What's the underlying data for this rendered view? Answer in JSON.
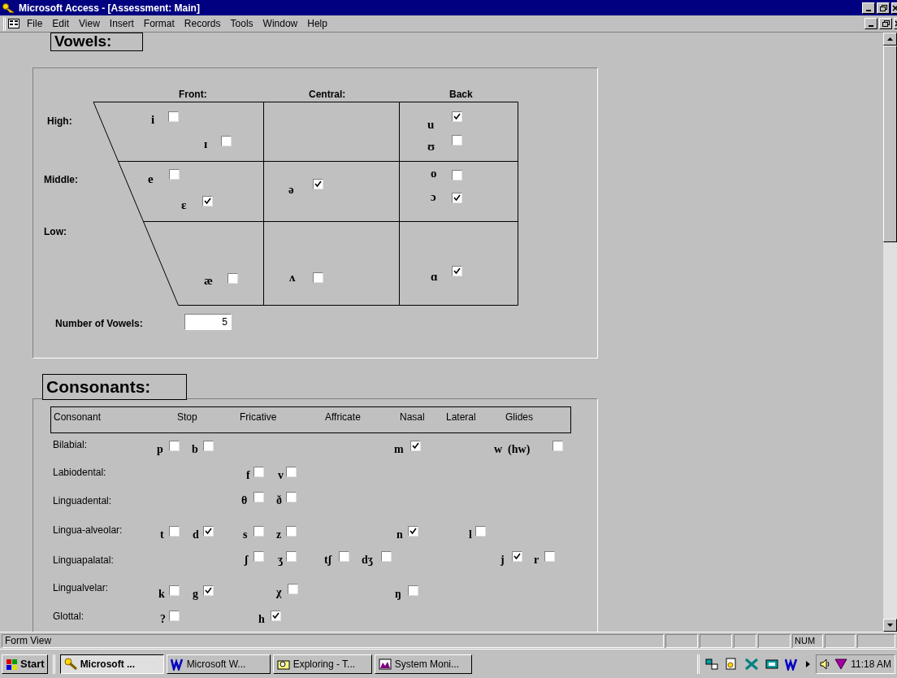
{
  "window": {
    "title": "Microsoft Access - [Assessment: Main]"
  },
  "menu": [
    "File",
    "Edit",
    "View",
    "Insert",
    "Format",
    "Records",
    "Tools",
    "Window",
    "Help"
  ],
  "vowels": {
    "title": "Vowels:",
    "columns": [
      "Front:",
      "Central:",
      "Back"
    ],
    "rows": [
      "High:",
      "Middle:",
      "Low:"
    ],
    "items": [
      {
        "symbol": "i",
        "checked": false
      },
      {
        "symbol": "ɪ",
        "checked": false
      },
      {
        "symbol": "e",
        "checked": false
      },
      {
        "symbol": "ɛ",
        "checked": true
      },
      {
        "symbol": "æ",
        "checked": false
      },
      {
        "symbol": "ə",
        "checked": true
      },
      {
        "symbol": "ʌ",
        "checked": false
      },
      {
        "symbol": "u",
        "checked": true
      },
      {
        "symbol": "ʊ",
        "checked": false
      },
      {
        "symbol": "o",
        "checked": false
      },
      {
        "symbol": "ɔ",
        "checked": true
      },
      {
        "symbol": "ɑ",
        "checked": true
      }
    ],
    "count_label": "Number of Vowels:",
    "count": "5"
  },
  "consonants": {
    "title": "Consonants:",
    "columns": [
      "Consonant",
      "Stop",
      "Fricative",
      "Affricate",
      "Nasal",
      "Lateral",
      "Glides"
    ],
    "rows": [
      "Bilabial:",
      "Labiodental:",
      "Linguadental:",
      "Lingua-alveolar:",
      "Linguapalatal:",
      "Lingualvelar:",
      "Glottal:"
    ],
    "items": [
      {
        "symbol": "p",
        "checked": false
      },
      {
        "symbol": "b",
        "checked": false
      },
      {
        "symbol": "m",
        "checked": true
      },
      {
        "symbol": "w  (hw)",
        "checked": false
      },
      {
        "symbol": "f",
        "checked": false
      },
      {
        "symbol": "v",
        "checked": false
      },
      {
        "symbol": "θ",
        "checked": false
      },
      {
        "symbol": "ð",
        "checked": false
      },
      {
        "symbol": "t",
        "checked": false
      },
      {
        "symbol": "d",
        "checked": true
      },
      {
        "symbol": "s",
        "checked": false
      },
      {
        "symbol": "z",
        "checked": false
      },
      {
        "symbol": "n",
        "checked": true
      },
      {
        "symbol": "l",
        "checked": false
      },
      {
        "symbol": "ʃ",
        "checked": false
      },
      {
        "symbol": "ʒ",
        "checked": false
      },
      {
        "symbol": "tʃ",
        "checked": false
      },
      {
        "symbol": "dʒ",
        "checked": false
      },
      {
        "symbol": "j",
        "checked": true
      },
      {
        "symbol": "r",
        "checked": false
      },
      {
        "symbol": "k",
        "checked": false
      },
      {
        "symbol": "g",
        "checked": true
      },
      {
        "symbol": "χ",
        "checked": false
      },
      {
        "symbol": "ŋ",
        "checked": false
      },
      {
        "symbol": "?",
        "checked": false
      },
      {
        "symbol": "h",
        "checked": true
      }
    ]
  },
  "status_bar": {
    "text": "Form View",
    "indicator": "NUM"
  },
  "taskbar": {
    "start": "Start",
    "tasks": [
      {
        "label": "Microsoft ...",
        "selected": true
      },
      {
        "label": "Microsoft W...",
        "selected": false
      },
      {
        "label": "Exploring - T...",
        "selected": false
      },
      {
        "label": "System Moni...",
        "selected": false
      }
    ],
    "clock": "11:18 AM"
  }
}
